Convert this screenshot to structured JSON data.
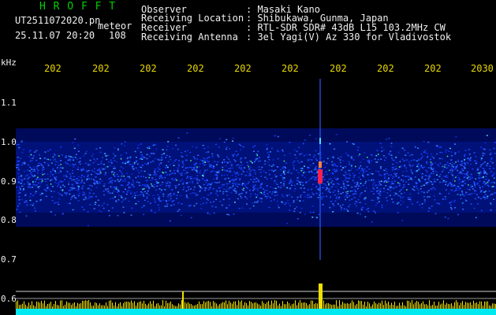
{
  "header": {
    "brand": "H R O F F T",
    "filename": "UT2511072020.pn",
    "meteor_label": "meteor",
    "datetime": "25.11.07 20:20",
    "count": "108"
  },
  "info": [
    {
      "label": "Observer",
      "value": ": Masaki Kano"
    },
    {
      "label": "Receiving Location",
      "value": ": Shibukawa, Gunma, Japan"
    },
    {
      "label": "Receiver",
      "value": ": RTL-SDR SDR# 43dB L15 103.2MHz CW"
    },
    {
      "label": "Receiving Antenna",
      "value": ": 3el Yagi(V) Az 330 for Vladivostok"
    }
  ],
  "axis": {
    "unit": "kHz",
    "y_ticks": [
      "1.1",
      "1.0",
      "0.9",
      "0.8",
      "0.7",
      "0.6"
    ],
    "x_ticks": [
      "202",
      "202",
      "202",
      "202",
      "202",
      "202",
      "202",
      "202",
      "202",
      "2030"
    ]
  },
  "colors": {
    "background": "#000000",
    "text": "#f0f0f0",
    "brand": "#00d000",
    "time_ticks": "#e8d800",
    "noise": "#1a3cff",
    "signal": "#ff2050",
    "bottom_bars": "#f0e000",
    "baseline": "#00e8f0"
  }
}
